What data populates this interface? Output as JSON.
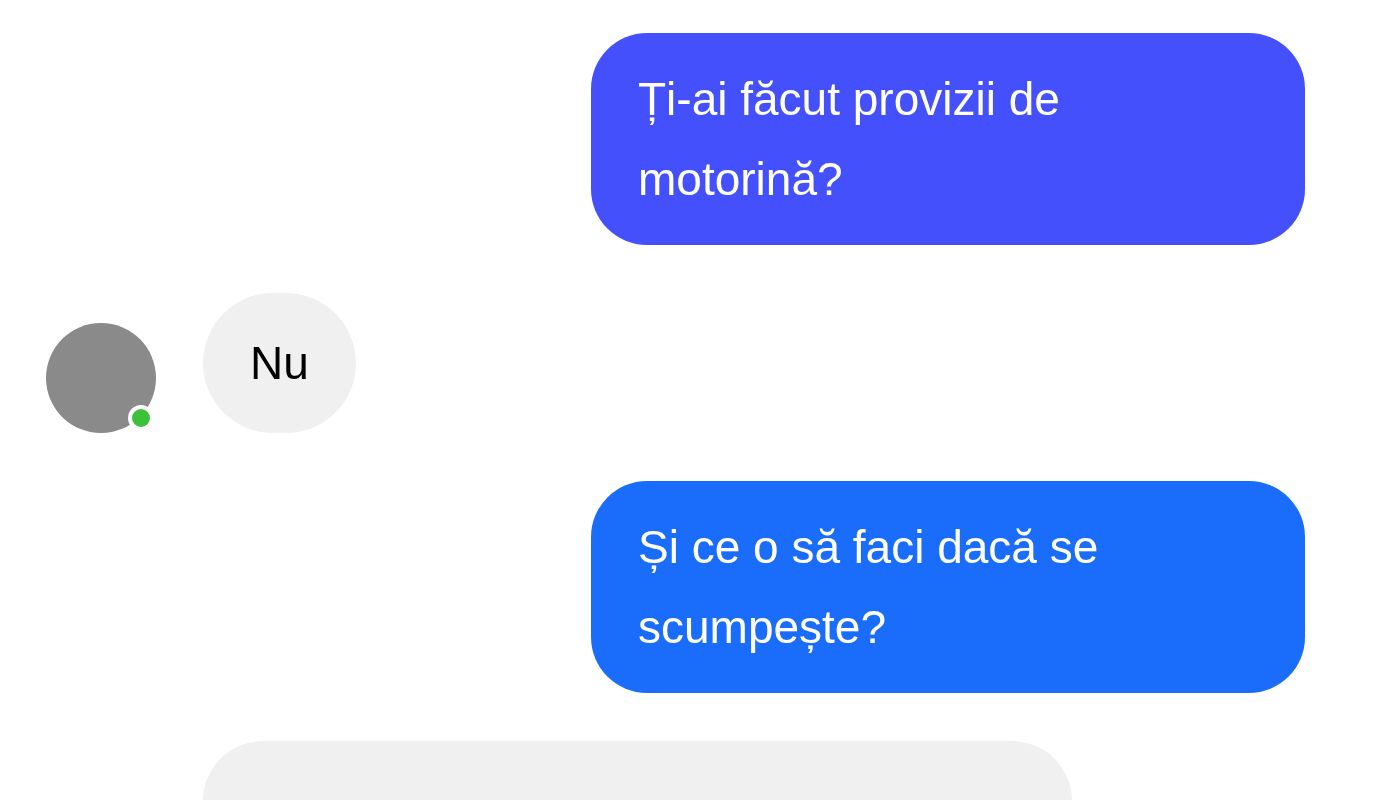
{
  "messages": [
    {
      "kind": "sent",
      "text": "Ți-ai făcut provizii de motorină?",
      "color": "#4350fb"
    },
    {
      "kind": "received",
      "text": "Nu",
      "avatar": true,
      "online": true
    },
    {
      "kind": "sent",
      "text": "Și ce o să faci dacă se scumpește?",
      "color": "#1a6dfb"
    },
    {
      "kind": "received",
      "cut_off": true
    }
  ]
}
